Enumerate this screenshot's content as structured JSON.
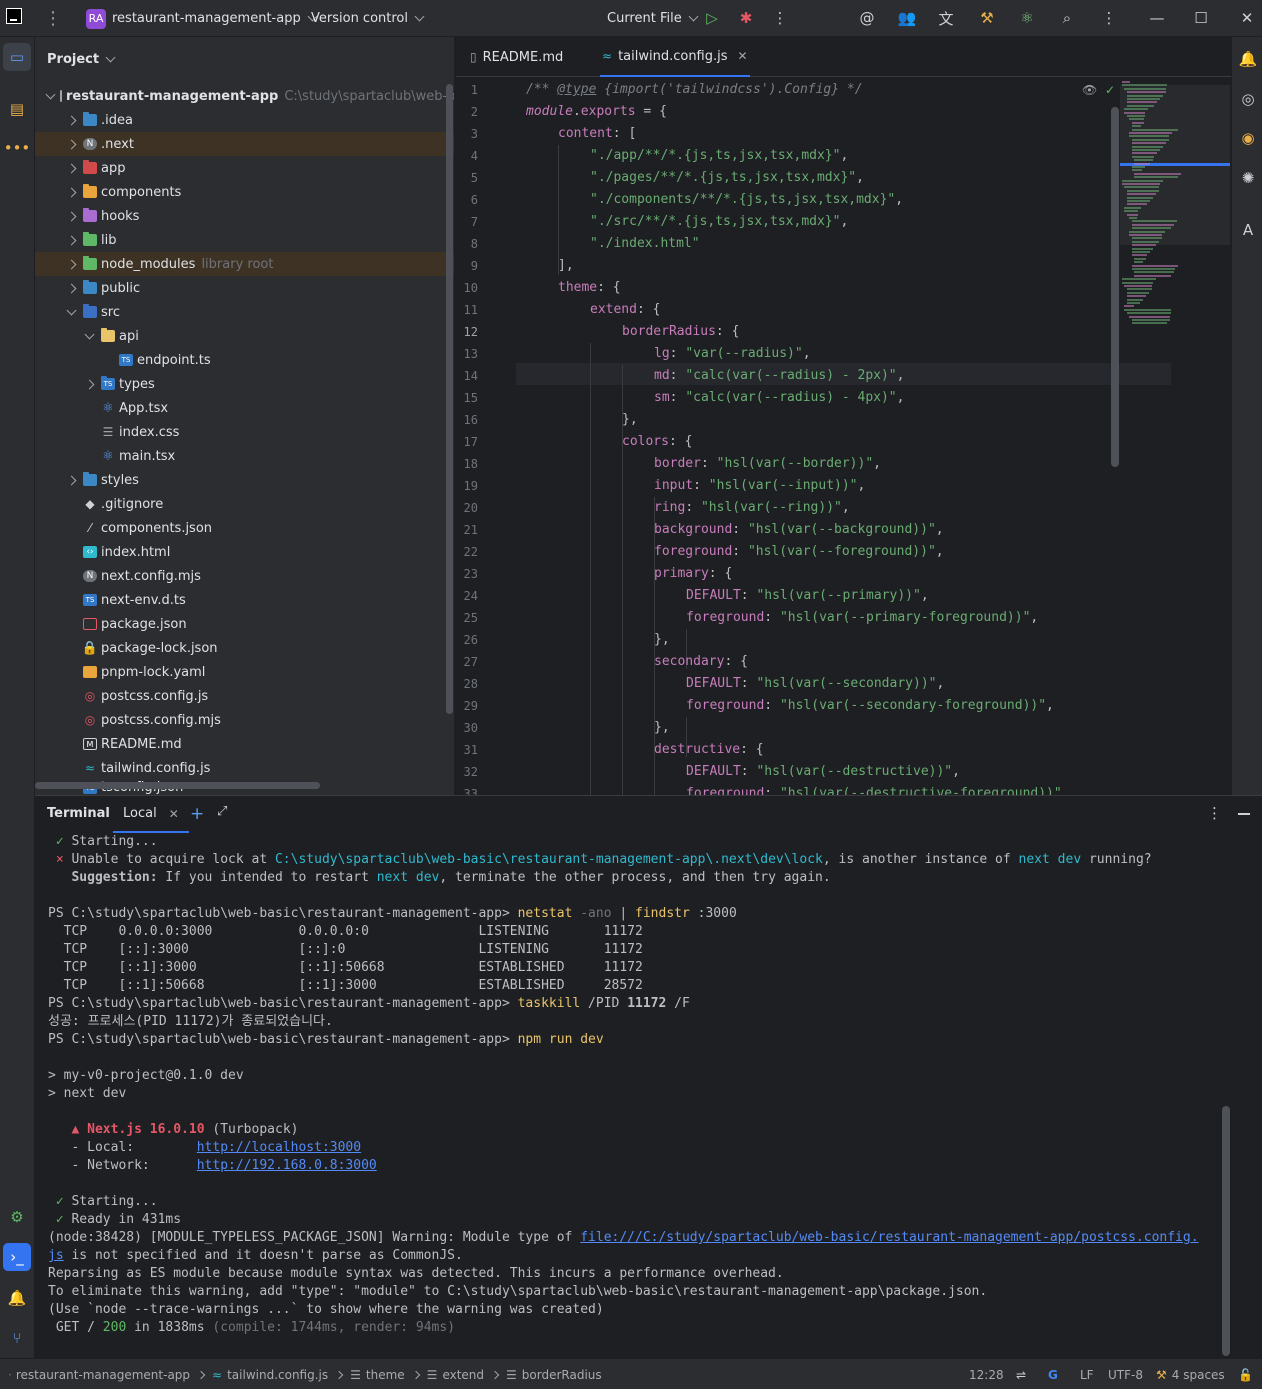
{
  "titlebar": {
    "project_badge": "RA",
    "project_name": "restaurant-management-app",
    "version_control": "Version control",
    "run_config": "Current File"
  },
  "project_panel": {
    "title": "Project",
    "root_name": "restaurant-management-app",
    "root_path": "C:\\study\\spartaclub\\web-basic\\re",
    "items": [
      {
        "label": ".idea",
        "hint": ""
      },
      {
        "label": ".next",
        "hint": ""
      },
      {
        "label": "app",
        "hint": ""
      },
      {
        "label": "components",
        "hint": ""
      },
      {
        "label": "hooks",
        "hint": ""
      },
      {
        "label": "lib",
        "hint": ""
      },
      {
        "label": "node_modules",
        "hint": "library root"
      },
      {
        "label": "public",
        "hint": ""
      },
      {
        "label": "src",
        "hint": ""
      },
      {
        "label": "api",
        "hint": ""
      },
      {
        "label": "endpoint.ts",
        "hint": ""
      },
      {
        "label": "types",
        "hint": ""
      },
      {
        "label": "App.tsx",
        "hint": ""
      },
      {
        "label": "index.css",
        "hint": ""
      },
      {
        "label": "main.tsx",
        "hint": ""
      },
      {
        "label": "styles",
        "hint": ""
      },
      {
        "label": ".gitignore",
        "hint": ""
      },
      {
        "label": "components.json",
        "hint": ""
      },
      {
        "label": "index.html",
        "hint": ""
      },
      {
        "label": "next.config.mjs",
        "hint": ""
      },
      {
        "label": "next-env.d.ts",
        "hint": ""
      },
      {
        "label": "package.json",
        "hint": ""
      },
      {
        "label": "package-lock.json",
        "hint": ""
      },
      {
        "label": "pnpm-lock.yaml",
        "hint": ""
      },
      {
        "label": "postcss.config.js",
        "hint": ""
      },
      {
        "label": "postcss.config.mjs",
        "hint": ""
      },
      {
        "label": "README.md",
        "hint": ""
      },
      {
        "label": "tailwind.config.js",
        "hint": ""
      },
      {
        "label": "tsconfig.json",
        "hint": ""
      }
    ]
  },
  "editor": {
    "tabs": [
      {
        "label": "README.md",
        "active": false
      },
      {
        "label": "tailwind.config.js",
        "active": true
      }
    ],
    "current_line": 12,
    "code": [
      "/** @type {import('tailwindcss').Config} */",
      "module.exports = {",
      "content: [",
      "\"./app/**/*.{js,ts,jsx,tsx,mdx}\",",
      "\"./pages/**/*.{js,ts,jsx,tsx,mdx}\",",
      "\"./components/**/*.{js,ts,jsx,tsx,mdx}\",",
      "\"./src/**/*.{js,ts,jsx,tsx,mdx}\",",
      "\"./index.html\"",
      "],",
      "theme: {",
      "extend: {",
      "borderRadius: {",
      "lg: \"var(--radius)\",",
      "md: \"calc(var(--radius) - 2px)\",",
      "sm: \"calc(var(--radius) - 4px)\",",
      "},",
      "colors: {",
      "border: \"hsl(var(--border))\",",
      "input: \"hsl(var(--input))\",",
      "ring: \"hsl(var(--ring))\",",
      "background: \"hsl(var(--background))\",",
      "foreground: \"hsl(var(--foreground))\",",
      "primary: {",
      "DEFAULT: \"hsl(var(--primary))\",",
      "foreground: \"hsl(var(--primary-foreground))\",",
      "},",
      "secondary: {",
      "DEFAULT: \"hsl(var(--secondary))\",",
      "foreground: \"hsl(var(--secondary-foreground))\",",
      "},",
      "destructive: {",
      "DEFAULT: \"hsl(var(--destructive))\",",
      "foreground: \"hsl(var(--destructive-foreground))\","
    ]
  },
  "terminal": {
    "title": "Terminal",
    "tab_label": "Local",
    "lines": {
      "l1_mark": "✓",
      "l1_text": "Starting...",
      "l2_mark": "×",
      "l2_a": "Unable to acquire lock at ",
      "l2_path": "C:\\study\\spartaclub\\web-basic\\restaurant-management-app\\.next\\dev\\lock",
      "l2_b": ", is another instance of ",
      "l2_cmd": "next dev",
      "l2_c": " running?",
      "l3_label": "Suggestion:",
      "l3_a": " If you intended to restart ",
      "l3_cmd": "next dev",
      "l3_b": ", terminate the other process, and then try again.",
      "prompt": "PS C:\\study\\spartaclub\\web-basic\\restaurant-management-app> ",
      "cmd1_a": "netstat",
      "cmd1_b": " -ano",
      "cmd1_c": " | ",
      "cmd1_d": "findstr",
      "cmd1_e": " :3000",
      "netstat": [
        "  TCP    0.0.0.0:3000           0.0.0.0:0              LISTENING       11172",
        "  TCP    [::]:3000              [::]:0                 LISTENING       11172",
        "  TCP    [::1]:3000             [::1]:50668            ESTABLISHED     11172",
        "  TCP    [::1]:50668            [::1]:3000             ESTABLISHED     28572"
      ],
      "cmd2_a": "taskkill",
      "cmd2_b": " /PID ",
      "cmd2_c": "11172",
      "cmd2_d": " /F",
      "kill_result": "성공: 프로세스(PID 11172)가 종료되었습니다.",
      "cmd3": "npm run dev",
      "npm1": "> my-v0-project@0.1.0 dev",
      "npm2": "> next dev",
      "next_mark": "▲",
      "next_name": "Next.js 16.0.10",
      "next_turbo": " (Turbopack)",
      "local_label": "   - Local:        ",
      "local_url": "http://localhost:3000",
      "network_label": "   - Network:      ",
      "network_url": "http://192.168.0.8:3000",
      "ok_mark": "✓",
      "starting": "Starting...",
      "ready": "Ready in 431ms",
      "warn1_a": "(node:38428) [MODULE_TYPELESS_PACKAGE_JSON] Warning: Module type of ",
      "warn1_url": "file:///C:/study/spartaclub/web-basic/restaurant-management-app/postcss.config.",
      "warn2_url": "js",
      "warn2_b": " is not specified and it doesn't parse as CommonJS.",
      "warn3": "Reparsing as ES module because module syntax was detected. This incurs a performance overhead.",
      "warn4": "To eliminate this warning, add \"type\": \"module\" to C:\\study\\spartaclub\\web-basic\\restaurant-management-app\\package.json.",
      "warn5": "(Use `node --trace-warnings ...` to show where the warning was created)",
      "get_a": " GET / ",
      "get_status": "200",
      "get_b": " in 1838ms",
      "get_c": " (compile: 1744ms, render: 94ms)"
    }
  },
  "statusbar": {
    "crumbs": [
      "restaurant-management-app",
      "tailwind.config.js",
      "theme",
      "extend",
      "borderRadius"
    ],
    "position": "12:28",
    "line_sep": "LF",
    "encoding": "UTF-8",
    "indent": "4 spaces"
  },
  "colors": {
    "accent": "#3574f0",
    "excluded_bg": "#3d3223",
    "string": "#6aab73",
    "keyword": "#cf8e6d",
    "property": "#c77dbb"
  }
}
